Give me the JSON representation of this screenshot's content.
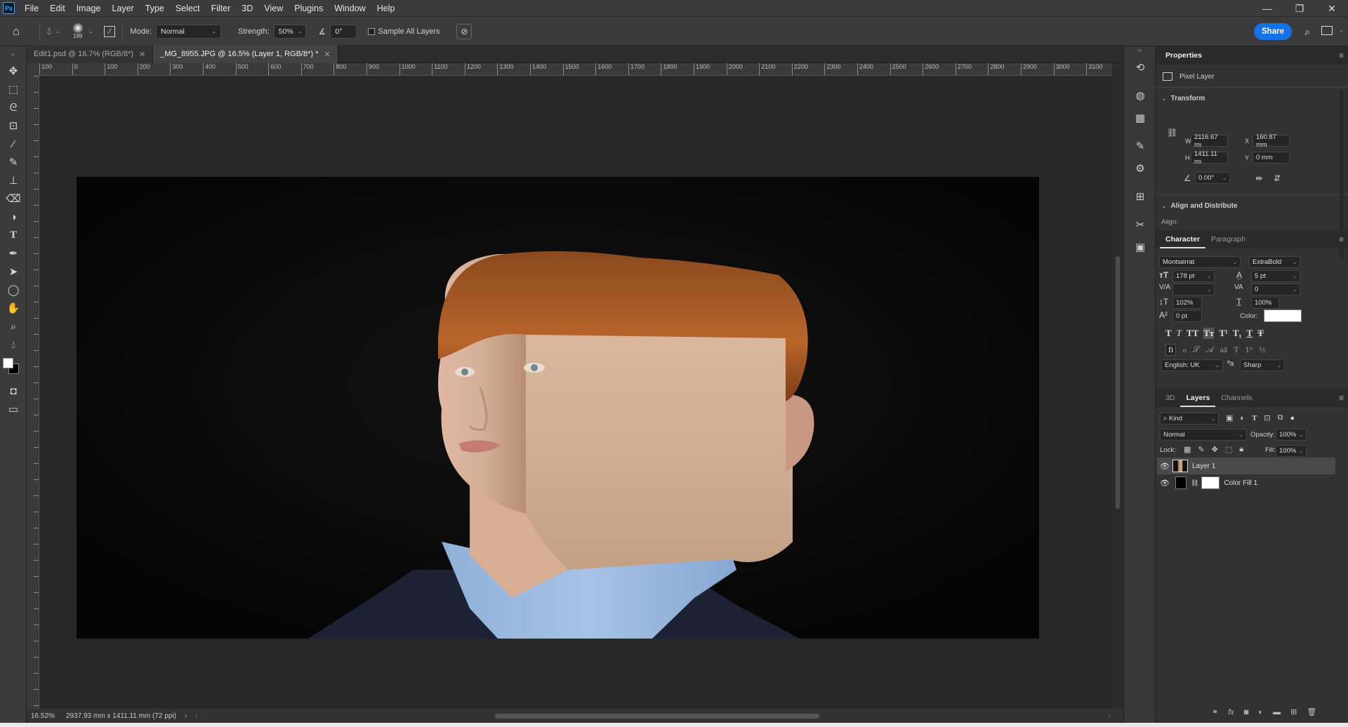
{
  "app": {
    "logo": "Ps"
  },
  "menu": [
    "File",
    "Edit",
    "Image",
    "Layer",
    "Type",
    "Select",
    "Filter",
    "3D",
    "View",
    "Plugins",
    "Window",
    "Help"
  ],
  "window_controls": {
    "minimize": "—",
    "restore": "❐",
    "close": "✕"
  },
  "options": {
    "brush_size": "199",
    "mode_label": "Mode:",
    "mode_value": "Normal",
    "strength_label": "Strength:",
    "strength_value": "50%",
    "angle_value": "0°",
    "sample_all_label": "Sample All Layers",
    "share_label": "Share"
  },
  "tabs": [
    {
      "label": "Edit1.psd @ 16.7% (RGB/8*)",
      "active": false
    },
    {
      "label": "_MG_8955.JPG @ 16.5% (Layer 1, RGB/8*) *",
      "active": true
    }
  ],
  "ruler_h": [
    "100",
    "0",
    "100",
    "200",
    "300",
    "400",
    "500",
    "600",
    "700",
    "800",
    "900",
    "1000",
    "1100",
    "1200",
    "1300",
    "1400",
    "1500",
    "1600",
    "1700",
    "1800",
    "1900",
    "2000",
    "2100",
    "2200",
    "2300",
    "2400",
    "2500",
    "2600",
    "2700",
    "2800",
    "2900",
    "3000",
    "3100"
  ],
  "status": {
    "zoom": "16.52%",
    "doc_size": "2937.93 mm x 1411.11 mm (72 ppi)"
  },
  "properties": {
    "title": "Properties",
    "type_label": "Pixel Layer",
    "transform_title": "Transform",
    "w_label": "W",
    "w_value": "2116.67 mı",
    "x_label": "X",
    "x_value": "160.87 mm",
    "h_label": "H",
    "h_value": "1411.11 mı",
    "y_label": "Y",
    "y_value": "0 mm",
    "angle_value": "0.00°",
    "align_title": "Align and Distribute",
    "align_label": "Align:"
  },
  "character": {
    "tabs": [
      "Character",
      "Paragraph"
    ],
    "font_family": "Montserrat",
    "font_style": "ExtraBold",
    "size": "178 pt",
    "leading": "5 pt",
    "kerning": "",
    "tracking": "0",
    "vscale": "102%",
    "hscale": "100%",
    "baseline": "0 pt",
    "color_label": "Color:",
    "language": "English: UK",
    "aa_label": "ªa",
    "antialias": "Sharp",
    "color_swatch": "#ffffff"
  },
  "layers_panel": {
    "tabs": [
      "3D",
      "Layers",
      "Channels"
    ],
    "filter_kind": "Kind",
    "blend_mode": "Normal",
    "opacity_label": "Opacity:",
    "opacity_value": "100%",
    "lock_label": "Lock:",
    "fill_label": "Fill:",
    "fill_value": "100%",
    "layers": [
      {
        "name": "Layer 1",
        "selected": true
      },
      {
        "name": "Color Fill 1",
        "selected": false
      }
    ]
  },
  "colors": {
    "accent": "#1473e6",
    "foreground": "#ffffff",
    "background": "#000000"
  }
}
